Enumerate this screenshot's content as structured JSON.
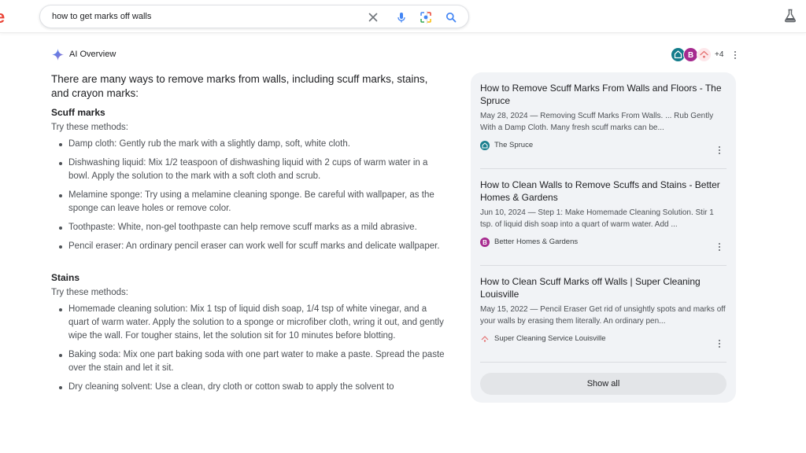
{
  "search": {
    "query": "how to get marks off walls",
    "icons": [
      "clear-icon",
      "microphone-icon",
      "lens-icon",
      "search-icon"
    ]
  },
  "header": {
    "labs_icon": "flask-icon"
  },
  "ai_overview": {
    "label": "AI Overview",
    "icon": "sparkle-icon",
    "sources_more": "+4",
    "intro": "There are many ways to remove marks from walls, including scuff marks, stains, and crayon marks:",
    "sections": [
      {
        "title": "Scuff marks",
        "try": "Try these methods:",
        "items": [
          "Damp cloth: Gently rub the mark with a slightly damp, soft, white cloth.",
          "Dishwashing liquid: Mix 1/2 teaspoon of dishwashing liquid with 2 cups of warm water in a bowl. Apply the solution to the mark with a soft cloth and scrub.",
          "Melamine sponge: Try using a melamine cleaning sponge. Be careful with wallpaper, as the sponge can leave holes or remove color.",
          "Toothpaste: White, non-gel toothpaste can help remove scuff marks as a mild abrasive.",
          "Pencil eraser: An ordinary pencil eraser can work well for scuff marks and delicate wallpaper."
        ]
      },
      {
        "title": "Stains",
        "try": "Try these methods:",
        "items": [
          "Homemade cleaning solution: Mix 1 tsp of liquid dish soap, 1/4 tsp of white vinegar, and a quart of warm water. Apply the solution to a sponge or microfiber cloth, wring it out, and gently wipe the wall. For tougher stains, let the solution sit for 10 minutes before blotting.",
          "Baking soda: Mix one part baking soda with one part water to make a paste. Spread the paste over the stain and let it sit.",
          "Dry cleaning solvent: Use a clean, dry cloth or cotton swab to apply the solvent to"
        ]
      }
    ]
  },
  "sources": {
    "cards": [
      {
        "title": "How to Remove Scuff Marks From Walls and Floors - The Spruce",
        "snippet": "May 28, 2024 — Removing Scuff Marks From Walls. ... Rub Gently With a Damp Cloth. Many fresh scuff marks can be...",
        "source": "The Spruce",
        "icon_color": "#1a7f8e"
      },
      {
        "title": "How to Clean Walls to Remove Scuffs and Stains - Better Homes & Gardens",
        "snippet": "Jun 10, 2024 — Step 1: Make Homemade Cleaning Solution. Stir 1 tsp. of liquid dish soap into a quart of warm water. Add ...",
        "source": "Better Homes & Gardens",
        "icon_color": "#a62a8f"
      },
      {
        "title": "How to Clean Scuff Marks off Walls | Super Cleaning Louisville",
        "snippet": "May 15, 2022 — Pencil Eraser Get rid of unsightly spots and marks off your walls by erasing them literally. An ordinary pen...",
        "source": "Super Cleaning Service Louisville",
        "icon_color": "#e57373"
      }
    ],
    "show_all": "Show all"
  }
}
